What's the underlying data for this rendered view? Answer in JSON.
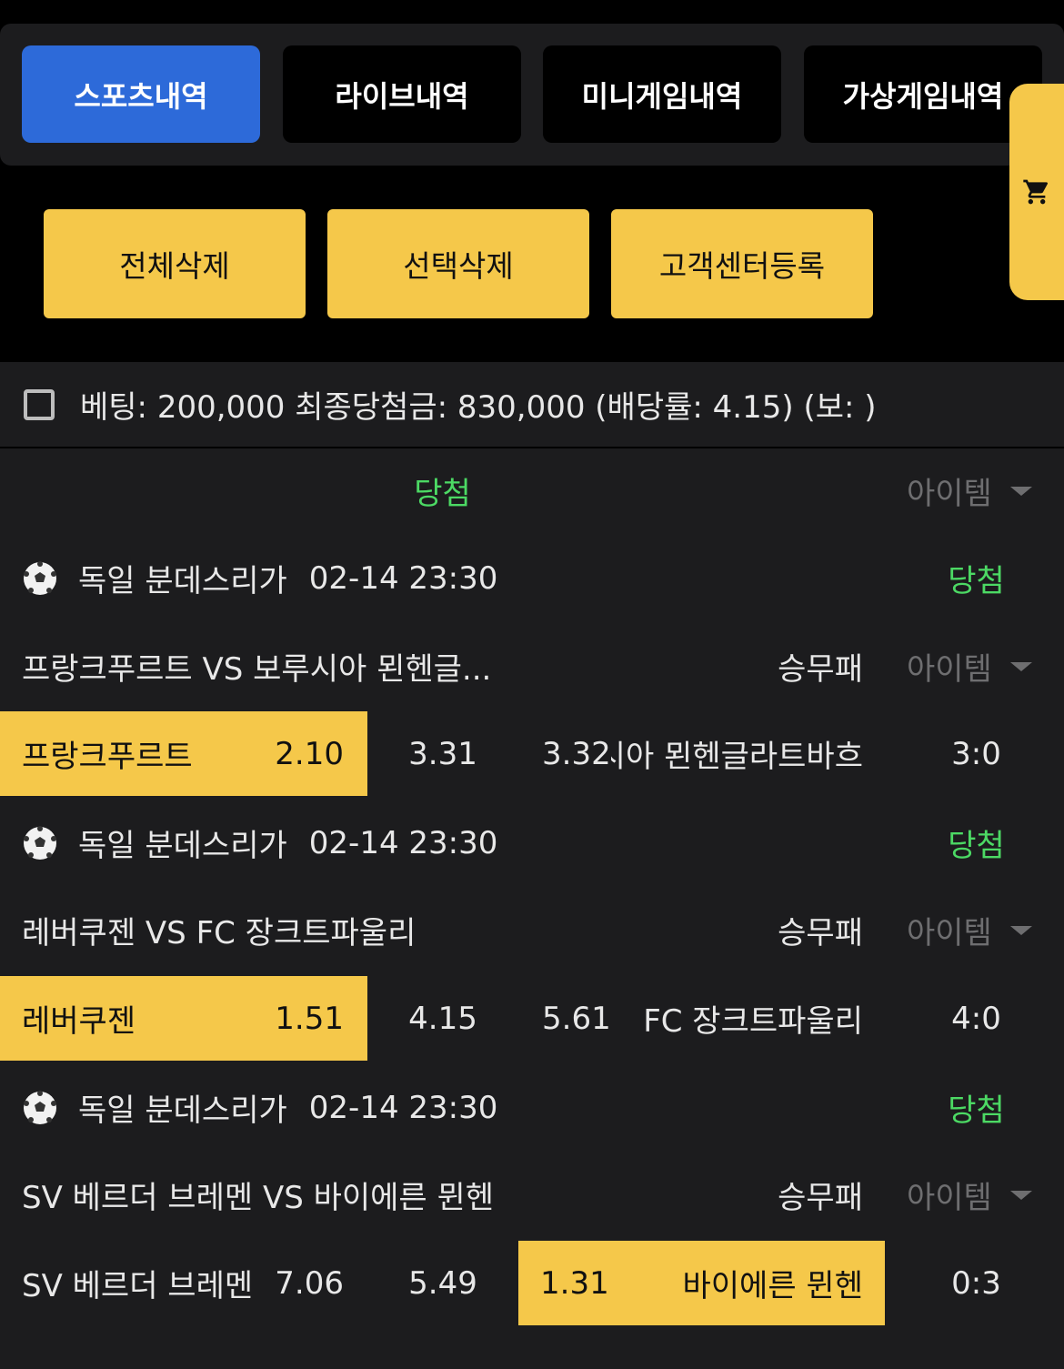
{
  "tabs": [
    {
      "label": "스포츠내역",
      "active": true
    },
    {
      "label": "라이브내역",
      "active": false
    },
    {
      "label": "미니게임내역",
      "active": false
    },
    {
      "label": "가상게임내역",
      "active": false
    }
  ],
  "actions": {
    "delete_all": "전체삭제",
    "delete_selected": "선택삭제",
    "register_support": "고객센터등록"
  },
  "cart_icon": "cart-icon",
  "summary": {
    "text": "베팅: 200,000 최종당첨금: 830,000 (배당률: 4.15) (보: )"
  },
  "header": {
    "status": "당첨",
    "item_label": "아이템"
  },
  "games": [
    {
      "league": "독일 분데스리가",
      "time": "02-14 23:30",
      "status": "당첨",
      "matchup": "프랑크푸르트 VS 보루시아 묀헨글...",
      "bet_type": "승무패",
      "item_label": "아이템",
      "home": "프랑크푸르트",
      "home_odds": "2.10",
      "draw_odds": "3.31",
      "away_odds": "3.32",
      "away": "보루시아 묀헨글라트바흐",
      "score": "3:0",
      "selected": "home"
    },
    {
      "league": "독일 분데스리가",
      "time": "02-14 23:30",
      "status": "당첨",
      "matchup": "레버쿠젠 VS FC 장크트파울리",
      "bet_type": "승무패",
      "item_label": "아이템",
      "home": "레버쿠젠",
      "home_odds": "1.51",
      "draw_odds": "4.15",
      "away_odds": "5.61",
      "away": "FC 장크트파울리",
      "score": "4:0",
      "selected": "home"
    },
    {
      "league": "독일 분데스리가",
      "time": "02-14 23:30",
      "status": "당첨",
      "matchup": "SV 베르더 브레멘 VS 바이에른 뮌헨",
      "bet_type": "승무패",
      "item_label": "아이템",
      "home": "SV 베르더 브레멘",
      "home_odds": "7.06",
      "draw_odds": "5.49",
      "away_odds": "1.31",
      "away": "바이에른 뮌헨",
      "score": "0:3",
      "selected": "away"
    }
  ]
}
